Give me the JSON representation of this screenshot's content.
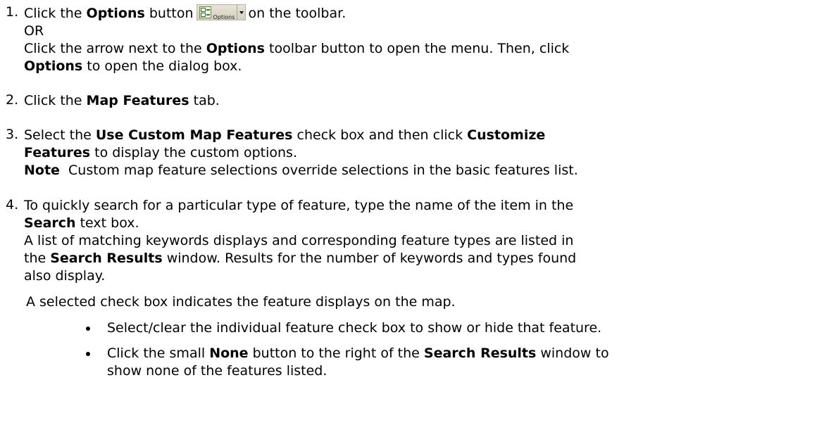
{
  "steps": [
    {
      "number": "1.",
      "lines": [
        {
          "parts": [
            "Click the ",
            "Options",
            " button",
            "on the toolbar."
          ]
        },
        {
          "parts": [
            "OR"
          ]
        },
        {
          "parts": [
            "Click the arrow next to the ",
            "Options",
            " toolbar button to open the menu. Then, click"
          ]
        },
        {
          "parts": [
            "Options",
            " to open the dialog box."
          ]
        }
      ],
      "toolbar_button": {
        "label": "Options",
        "icon": "checklist-icon",
        "dropdown_icon": "dropdown-arrow-icon"
      }
    },
    {
      "number": "2.",
      "lines": [
        {
          "parts": [
            "Click the ",
            "Map Features",
            " tab."
          ]
        }
      ]
    },
    {
      "number": "3.",
      "lines": [
        {
          "parts": [
            "Select the ",
            "Use Custom Map Features",
            " check box and then click ",
            "Customize"
          ]
        },
        {
          "parts": [
            "Features",
            " to display the custom options."
          ]
        },
        {
          "parts": [
            "Note",
            "  Custom map feature selections override selections in the basic features list."
          ]
        }
      ]
    },
    {
      "number": "4.",
      "lines": [
        {
          "parts": [
            "To quickly search for a particular type of feature, type the name of the item in the"
          ]
        },
        {
          "parts": [
            "Search",
            " text box."
          ]
        },
        {
          "parts": [
            "A list of matching keywords displays and corresponding feature types are listed in"
          ]
        },
        {
          "parts": [
            "the ",
            "Search Results",
            " window. Results for the number of keywords and types found"
          ]
        },
        {
          "parts": [
            "also display."
          ]
        }
      ]
    }
  ],
  "after_text": "A selected check box indicates the feature displays on the map.",
  "bullets": [
    {
      "lines": [
        {
          "parts": [
            "Select/clear the individual feature check box to show or hide that feature."
          ]
        }
      ]
    },
    {
      "lines": [
        {
          "parts": [
            "Click the small ",
            "None",
            " button to the right of the ",
            "Search Results",
            " window to"
          ]
        },
        {
          "parts": [
            "show none of the features listed."
          ]
        }
      ]
    }
  ]
}
